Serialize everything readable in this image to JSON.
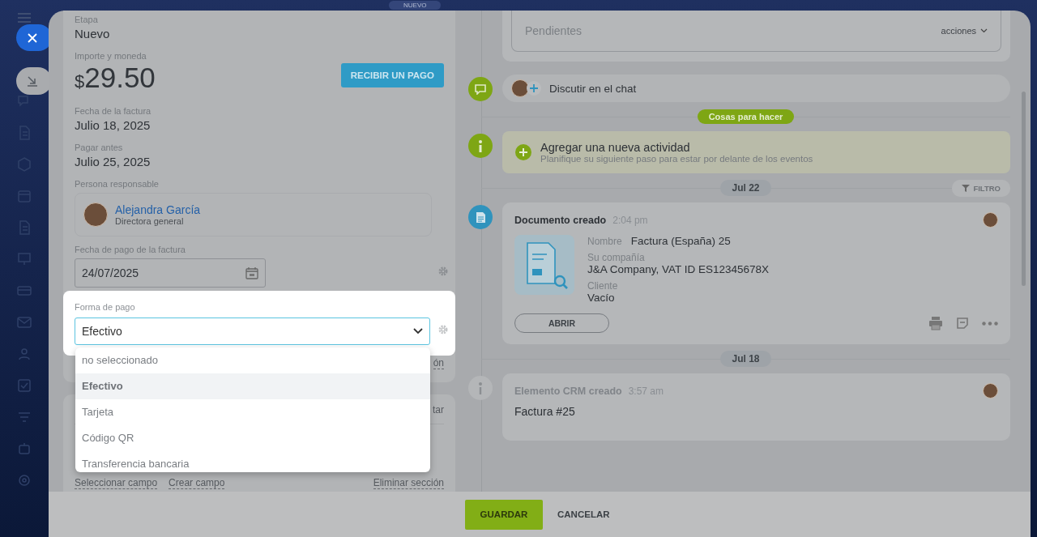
{
  "top_badge": "NUEVO",
  "fields": [
    {
      "kind": "text",
      "label": "Etapa",
      "value": "Nuevo"
    },
    {
      "kind": "amount",
      "label": "Importe y moneda",
      "currency": "$",
      "value": "29.50",
      "button": "RECIBIR UN PAGO"
    },
    {
      "kind": "text",
      "label": "Fecha de la factura",
      "value": "Julio 18, 2025"
    },
    {
      "kind": "text",
      "label": "Pagar antes",
      "value": "Julio 25, 2025"
    },
    {
      "kind": "person",
      "label": "Persona responsable",
      "name": "Alejandra García",
      "role": "Directora general"
    },
    {
      "kind": "date",
      "label": "Fecha de pago de la factura",
      "value": "24/07/2025"
    }
  ],
  "payment_field": {
    "label": "Forma de pago",
    "value": "Efectivo",
    "options": [
      {
        "label": "no seleccionado",
        "selected": false
      },
      {
        "label": "Efectivo",
        "selected": true
      },
      {
        "label": "Tarjeta",
        "selected": false
      },
      {
        "label": "Código QR",
        "selected": false
      },
      {
        "label": "Transferencia bancaria",
        "selected": false
      }
    ]
  },
  "section_link_fragment": "ón",
  "second_section": {
    "header_fragment": "tar",
    "links": [
      "Seleccionar campo",
      "Crear campo"
    ],
    "delete_link": "Eliminar sección"
  },
  "timeline": {
    "pending": {
      "placeholder": "Pendientes",
      "actions": "acciones"
    },
    "chat": "Discutir en el chat",
    "todo_badge": "Cosas para hacer",
    "activity": {
      "title": "Agregar una nueva actividad",
      "subtitle": "Planifique su siguiente paso para estar por delante de los eventos"
    },
    "filter": "FILTRO",
    "groups": [
      {
        "date": "Jul 22",
        "items": [
          {
            "kind": "document",
            "title": "Documento creado",
            "time": "2:04 pm",
            "fields": [
              {
                "label": "Nombre",
                "value": "Factura (España) 25",
                "inline": true
              },
              {
                "label": "Su compañía",
                "value": "J&A Company, VAT ID ES12345678X",
                "inline": false
              },
              {
                "label": "Cliente",
                "value": "Vacío",
                "inline": false
              }
            ],
            "button": "ABRIR"
          }
        ]
      },
      {
        "date": "Jul 18",
        "items": [
          {
            "kind": "info",
            "title": "Elemento CRM creado",
            "time": "3:57 am",
            "text": "Factura #25"
          }
        ]
      }
    ]
  },
  "footer": {
    "save": "GUARDAR",
    "cancel": "CANCELAR"
  }
}
